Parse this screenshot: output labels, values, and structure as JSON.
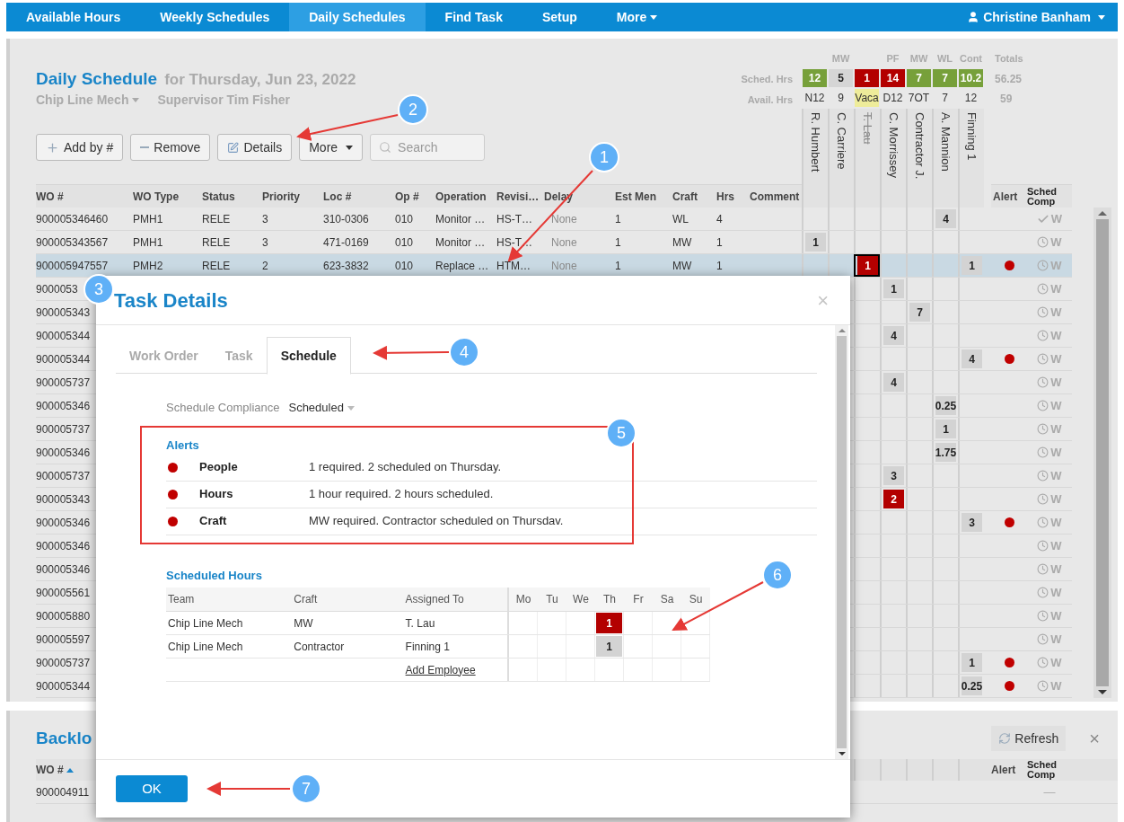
{
  "nav": {
    "tabs": [
      {
        "label": "Available Hours",
        "selected": false
      },
      {
        "label": "Weekly Schedules",
        "selected": false
      },
      {
        "label": "Daily Schedules",
        "selected": true
      },
      {
        "label": "Find Task",
        "selected": false
      },
      {
        "label": "Setup",
        "selected": false
      },
      {
        "label": "More",
        "selected": false,
        "kind": "menu"
      }
    ],
    "user": "Christine Banham"
  },
  "schedule": {
    "title": "Daily Schedule",
    "date": "for Thursday, Jun 23, 2022",
    "team": "Chip Line Mech",
    "supervisor": "Supervisor Tim Fisher",
    "sched_label": "Sched. Hrs",
    "avail_label": "Avail. Hrs",
    "toolbar": [
      {
        "kind": "add",
        "label": "Add by #"
      },
      {
        "kind": "remove",
        "label": "Remove"
      },
      {
        "kind": "details",
        "label": "Details"
      },
      {
        "kind": "menu",
        "label": "More"
      }
    ],
    "search_placeholder": "Search",
    "columns": [
      "WO #",
      "WO Type",
      "Status",
      "Priority",
      "Loc #",
      "Op #",
      "Operation",
      "Revisi…",
      "Delay",
      "Est Men",
      "Craft",
      "Hrs",
      "Comment"
    ],
    "groups": [
      {
        "label": "MW",
        "employees": [
          {
            "name": "R. Humbert",
            "sched": "12",
            "color": "#77a03a",
            "avail": "N12",
            "on_vacation": false,
            "inactive": false
          },
          {
            "name": "C. Carriere",
            "sched": "5",
            "color": "#d5d5d5",
            "avail": "9",
            "on_vacation": false,
            "inactive": false
          },
          {
            "name": "T. Lau",
            "sched": "1",
            "color": "#b30000",
            "avail": "Vaca",
            "on_vacation": true,
            "inactive": true
          }
        ]
      },
      {
        "label": "PF",
        "employees": [
          {
            "name": "C. Morrissey",
            "sched": "14",
            "color": "#b30000",
            "avail": "D12",
            "on_vacation": false,
            "inactive": false
          }
        ]
      },
      {
        "label": "MW",
        "employees": [
          {
            "name": "Contractor J.",
            "sched": "7",
            "color": "#77a03a",
            "avail": "7OT",
            "on_vacation": false,
            "inactive": false
          }
        ]
      },
      {
        "label": "WL",
        "employees": [
          {
            "name": "A. Mannion",
            "sched": "7",
            "color": "#77a03a",
            "avail": "7",
            "on_vacation": false,
            "inactive": false
          }
        ]
      },
      {
        "label": "Cont",
        "employees": [
          {
            "name": "Finning 1",
            "sched": "10.2",
            "color": "#77a03a",
            "avail": "12",
            "on_vacation": false,
            "inactive": false
          }
        ]
      }
    ],
    "totals": {
      "label": "Totals",
      "sched": "56.25",
      "avail": "59"
    },
    "alert_column": "Alert",
    "comp_column": "Sched Comp",
    "rows": [
      {
        "wo": "900005346460",
        "wo_type": "PMH1",
        "status": "RELE",
        "priority": "3",
        "loc": "310-0306",
        "op": "010",
        "operation": "Monitor …",
        "revision": "HS-T…",
        "delay": "None",
        "est_men": "1",
        "craft": "WL",
        "hrs": "4",
        "selected": false,
        "hours": [
          {
            "filled": false
          },
          {
            "filled": false
          },
          {
            "filled": false
          },
          {
            "filled": false
          },
          {
            "filled": false
          },
          {
            "filled": true,
            "value": "4",
            "color": "#d3d3d3"
          },
          {
            "filled": false
          }
        ],
        "alert": false,
        "comp": {
          "kind": "done",
          "label": "W"
        }
      },
      {
        "wo": "900005343567",
        "wo_type": "PMH1",
        "status": "RELE",
        "priority": "3",
        "loc": "471-0169",
        "op": "010",
        "operation": "Monitor …",
        "revision": "HS-T…",
        "delay": "None",
        "est_men": "1",
        "craft": "MW",
        "hrs": "1",
        "selected": false,
        "hours": [
          {
            "filled": true,
            "value": "1",
            "color": "#d3d3d3"
          },
          {
            "filled": false
          },
          {
            "filled": false
          },
          {
            "filled": false
          },
          {
            "filled": false
          },
          {
            "filled": false
          },
          {
            "filled": false
          }
        ],
        "alert": false,
        "comp": {
          "kind": "pending",
          "label": "W"
        }
      },
      {
        "wo": "900005947557",
        "wo_type": "PMH2",
        "status": "RELE",
        "priority": "2",
        "loc": "623-3832",
        "op": "010",
        "operation": "Replace …",
        "revision": "HTM…",
        "delay": "None",
        "est_men": "1",
        "craft": "MW",
        "hrs": "1",
        "selected": true,
        "hours": [
          {
            "filled": false
          },
          {
            "filled": false
          },
          {
            "filled": true,
            "value": "1",
            "color": "#b30000",
            "focused": true
          },
          {
            "filled": false
          },
          {
            "filled": false
          },
          {
            "filled": false
          },
          {
            "filled": true,
            "value": "1",
            "color": "#d3d3d3"
          }
        ],
        "alert": true,
        "comp": {
          "kind": "pending",
          "label": "W"
        }
      },
      {
        "wo": "9000053",
        "selected": false,
        "hours": [
          {
            "filled": false
          },
          {
            "filled": true,
            "value": "1",
            "color": "#d3d3d3"
          },
          {
            "filled": false
          },
          {
            "filled": false
          },
          {
            "filled": false
          }
        ],
        "alert": false,
        "comp": {
          "kind": "pending",
          "label": "W"
        }
      },
      {
        "wo": "900005343",
        "selected": false,
        "hours": [
          {
            "filled": false
          },
          {
            "filled": false
          },
          {
            "filled": true,
            "value": "7",
            "color": "#d3d3d3"
          },
          {
            "filled": false
          },
          {
            "filled": false
          }
        ],
        "alert": false,
        "comp": {
          "kind": "pending",
          "label": "W"
        }
      },
      {
        "wo": "900005344",
        "selected": false,
        "hours": [
          {
            "filled": false
          },
          {
            "filled": true,
            "value": "4",
            "color": "#d3d3d3"
          },
          {
            "filled": false
          },
          {
            "filled": false
          },
          {
            "filled": false
          }
        ],
        "alert": false,
        "comp": {
          "kind": "pending",
          "label": "W"
        }
      },
      {
        "wo": "900005344",
        "selected": false,
        "hours": [
          {
            "filled": false
          },
          {
            "filled": false
          },
          {
            "filled": false
          },
          {
            "filled": false
          },
          {
            "filled": true,
            "value": "4",
            "color": "#d3d3d3"
          }
        ],
        "alert": true,
        "comp": {
          "kind": "pending",
          "label": "W"
        }
      },
      {
        "wo": "900005737",
        "selected": false,
        "hours": [
          {
            "filled": false
          },
          {
            "filled": true,
            "value": "4",
            "color": "#d3d3d3"
          },
          {
            "filled": false
          },
          {
            "filled": false
          },
          {
            "filled": false
          }
        ],
        "alert": false,
        "comp": {
          "kind": "pending",
          "label": "W"
        }
      },
      {
        "wo": "900005346",
        "selected": false,
        "hours": [
          {
            "filled": false
          },
          {
            "filled": false
          },
          {
            "filled": false
          },
          {
            "filled": true,
            "value": "0.25",
            "color": "#d3d3d3"
          },
          {
            "filled": false
          }
        ],
        "alert": false,
        "comp": {
          "kind": "pending",
          "label": "W"
        }
      },
      {
        "wo": "900005737",
        "selected": false,
        "hours": [
          {
            "filled": false
          },
          {
            "filled": false
          },
          {
            "filled": false
          },
          {
            "filled": true,
            "value": "1",
            "color": "#d3d3d3"
          },
          {
            "filled": false
          }
        ],
        "alert": false,
        "comp": {
          "kind": "pending",
          "label": "W"
        }
      },
      {
        "wo": "900005346",
        "selected": false,
        "hours": [
          {
            "filled": false
          },
          {
            "filled": false
          },
          {
            "filled": false
          },
          {
            "filled": true,
            "value": "1.75",
            "color": "#d3d3d3"
          },
          {
            "filled": false
          }
        ],
        "alert": false,
        "comp": {
          "kind": "pending",
          "label": "W"
        }
      },
      {
        "wo": "900005737",
        "selected": false,
        "hours": [
          {
            "filled": false
          },
          {
            "filled": true,
            "value": "3",
            "color": "#d3d3d3"
          },
          {
            "filled": false
          },
          {
            "filled": false
          },
          {
            "filled": false
          }
        ],
        "alert": false,
        "comp": {
          "kind": "pending",
          "label": "W"
        }
      },
      {
        "wo": "900005343",
        "selected": false,
        "hours": [
          {
            "filled": false
          },
          {
            "filled": true,
            "value": "2",
            "color": "#b30000"
          },
          {
            "filled": false
          },
          {
            "filled": false
          },
          {
            "filled": false
          }
        ],
        "alert": false,
        "comp": {
          "kind": "pending",
          "label": "W"
        }
      },
      {
        "wo": "900005346",
        "selected": false,
        "hours": [
          {
            "filled": false
          },
          {
            "filled": false
          },
          {
            "filled": false
          },
          {
            "filled": false
          },
          {
            "filled": true,
            "value": "3",
            "color": "#d3d3d3"
          }
        ],
        "alert": true,
        "comp": {
          "kind": "pending",
          "label": "W"
        }
      },
      {
        "wo": "900005346",
        "selected": false,
        "alert": false,
        "comp": {
          "kind": "pending",
          "label": "W"
        }
      },
      {
        "wo": "900005346",
        "selected": false,
        "alert": false,
        "comp": {
          "kind": "pending",
          "label": "W"
        }
      },
      {
        "wo": "900005561",
        "selected": false,
        "alert": false,
        "comp": {
          "kind": "pending",
          "label": "W"
        }
      },
      {
        "wo": "900005880",
        "selected": false,
        "alert": false,
        "comp": {
          "kind": "pending",
          "label": "W"
        }
      },
      {
        "wo": "900005597",
        "selected": false,
        "alert": false,
        "comp": {
          "kind": "pending",
          "label": "W"
        }
      },
      {
        "wo": "900005737",
        "selected": false,
        "hours": [
          {
            "filled": false
          },
          {
            "filled": false
          },
          {
            "filled": false
          },
          {
            "filled": false
          },
          {
            "filled": true,
            "value": "1",
            "color": "#d3d3d3"
          }
        ],
        "alert": true,
        "comp": {
          "kind": "pending",
          "label": "W"
        }
      },
      {
        "wo": "900005344",
        "selected": false,
        "hours": [
          {
            "filled": false
          },
          {
            "filled": false
          },
          {
            "filled": false
          },
          {
            "filled": false
          },
          {
            "filled": true,
            "value": "0.25",
            "color": "#d3d3d3"
          }
        ],
        "alert": true,
        "comp": {
          "kind": "pending",
          "label": "W"
        }
      }
    ]
  },
  "backlog": {
    "title": "Backlo",
    "refresh": "Refresh",
    "close": "×",
    "sort_column": "WO #",
    "alert_column": "Alert",
    "comp_column": "Sched Comp",
    "rows": [
      {
        "wo": "900004911",
        "comp": "—"
      }
    ]
  },
  "dialog": {
    "title": "Task Details",
    "close": "×",
    "tabs": [
      {
        "label": "Work Order",
        "selected": false
      },
      {
        "label": "Task",
        "selected": false
      },
      {
        "label": "Schedule",
        "selected": true
      }
    ],
    "compliance_label": "Schedule Compliance",
    "compliance_value": "Scheduled",
    "alerts_title": "Alerts",
    "alerts": [
      {
        "label": "People",
        "message": "1 required. 2 scheduled on Thursday.",
        "color": "#c00000"
      },
      {
        "label": "Hours",
        "message": "1 hour required. 2 hours scheduled.",
        "color": "#c00000"
      },
      {
        "label": "Craft",
        "message": "MW required. Contractor scheduled on Thursdav.",
        "color": "#c00000"
      }
    ],
    "hours_title": "Scheduled Hours",
    "hours_columns": [
      "Team",
      "Craft",
      "Assigned To"
    ],
    "days": [
      "Mo",
      "Tu",
      "We",
      "Th",
      "Fr",
      "Sa",
      "Su"
    ],
    "assignments": [
      {
        "team": "Chip Line Mech",
        "craft": "MW",
        "assigned_to": "T. Lau",
        "days": [
          {
            "filled": false
          },
          {
            "filled": false
          },
          {
            "filled": false
          },
          {
            "filled": true,
            "value": "1",
            "color": "#b30000"
          },
          {
            "filled": false
          },
          {
            "filled": false
          },
          {
            "filled": false
          }
        ]
      },
      {
        "team": "Chip Line Mech",
        "craft": "Contractor",
        "assigned_to": "Finning 1",
        "days": [
          {
            "filled": false
          },
          {
            "filled": false
          },
          {
            "filled": false
          },
          {
            "filled": true,
            "value": "1",
            "color": "#d3d3d3"
          },
          {
            "filled": false
          },
          {
            "filled": false
          },
          {
            "filled": false
          }
        ]
      }
    ],
    "add_link": "Add Employee",
    "ok": "OK"
  },
  "callouts": [
    {
      "label": "1"
    },
    {
      "label": "2"
    },
    {
      "label": "3"
    },
    {
      "label": "4"
    },
    {
      "label": "5"
    },
    {
      "label": "6"
    },
    {
      "label": "7"
    }
  ]
}
